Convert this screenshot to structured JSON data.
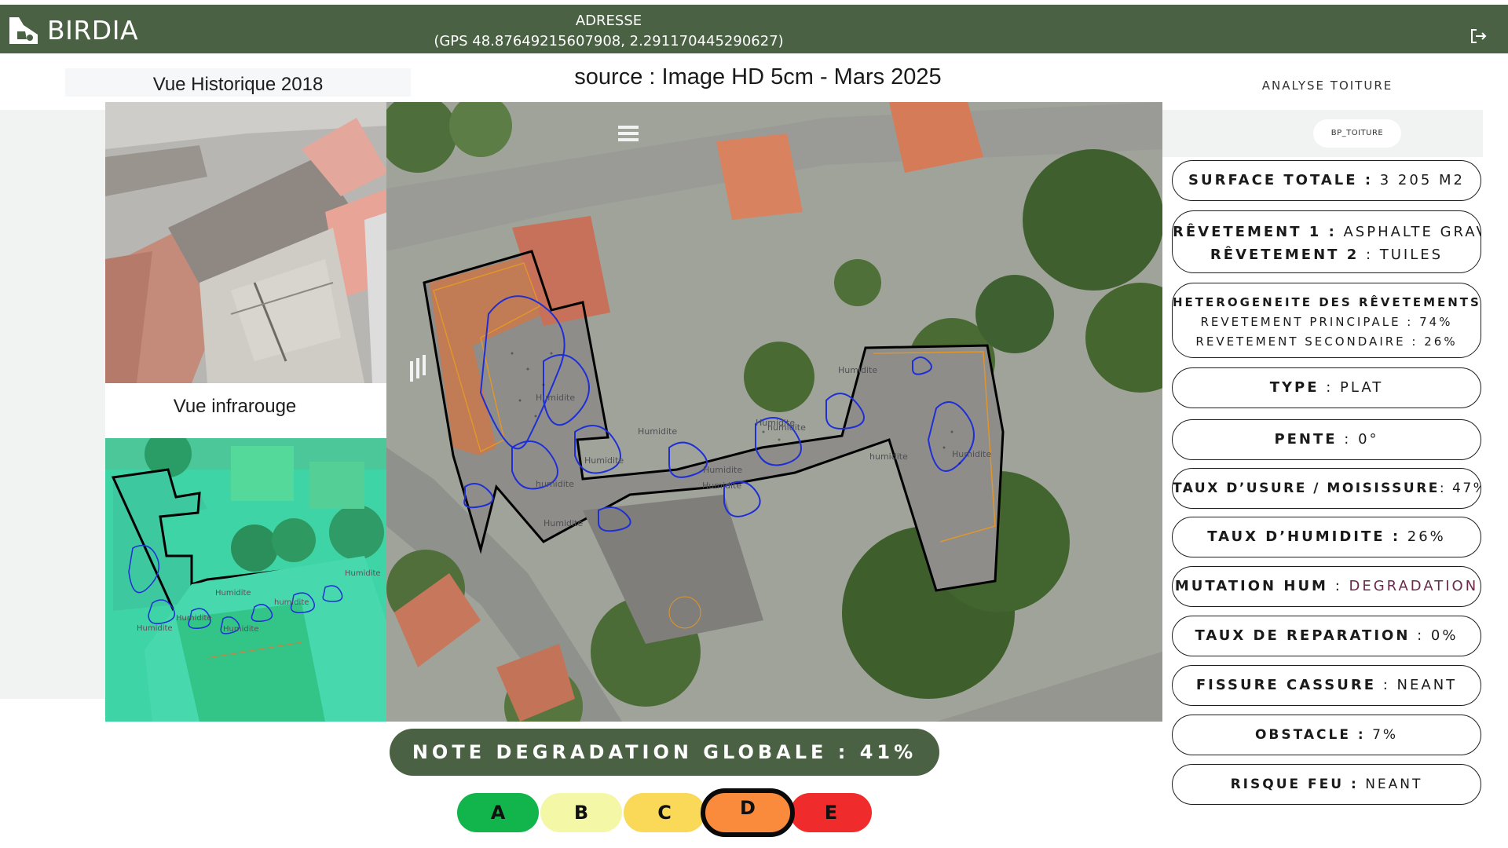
{
  "header": {
    "brand": "BIRDIA",
    "address_label": "ADRESSE",
    "address_value": "(GPS 48.87649215607908, 2.291170445290627)"
  },
  "left_panel": {
    "historic_title": "Vue Historique 2018",
    "infrared_title": "Vue infrarouge"
  },
  "main_view": {
    "source_title": "source : Image HD 5cm - Mars 2025",
    "map_annotations": [
      "Humidite",
      "humidite",
      "Humidite",
      "Humidite",
      "Humidite",
      "Humidite",
      "humidite",
      "Humidite",
      "humidite",
      "Humidite",
      "Humidite",
      "Humidite"
    ]
  },
  "infrared_annotations": [
    "Humidite",
    "humidite",
    "Humidite",
    "Humidite",
    "Humidite",
    "Humidite"
  ],
  "analysis": {
    "title": "ANALYSE TOITURE",
    "chip": "BP_TOITURE",
    "items": [
      {
        "key": "SURFACE TOTALE :",
        "value": " 3 205 M2"
      },
      {
        "key": "RÊVETEMENT 1 :",
        "value": " ASPHALTE GRAV",
        "key2": "RÊVETEMENT 2",
        "value2": " : TUILES"
      },
      {
        "key": "HETEROGENEITE DES RÊVETEMENTS :",
        "line2": "REVETEMENT PRINCIPALE : 74%",
        "line3": "REVETEMENT SECONDAIRE : 26%"
      },
      {
        "key": "TYPE",
        "value": " : PLAT"
      },
      {
        "key": "PENTE",
        "value": " : 0°"
      },
      {
        "key": "TAUX D’USURE / MOISISSURE",
        "value": ": 47%"
      },
      {
        "key": "TAUX D’HUMIDITE :",
        "value": " 26%"
      },
      {
        "key": "MUTATION HUM",
        "sep": " : ",
        "value": "DEGRADATION"
      },
      {
        "key": "TAUX DE REPARATION",
        "value": " : 0%"
      },
      {
        "key": "FISSURE CASSURE",
        "value": " : NEANT"
      },
      {
        "key": "OBSTACLE :",
        "value": " 7%"
      },
      {
        "key": "RISQUE FEU :",
        "value": " NEANT"
      }
    ]
  },
  "global_note": {
    "label": "NOTE DEGRADATION GLOBALE : 41%",
    "degradation_pct": 41
  },
  "grades": [
    {
      "letter": "A",
      "color": "#12b54b"
    },
    {
      "letter": "B",
      "color": "#f3f7a6"
    },
    {
      "letter": "C",
      "color": "#f9d957"
    },
    {
      "letter": "D",
      "color": "#fb8b3c",
      "selected": true
    },
    {
      "letter": "E",
      "color": "#ef2b2b"
    }
  ],
  "colors": {
    "brand_green": "#4a6144",
    "moisture_outline": "#1f2fd6",
    "roof_outline": "#000000",
    "texture_outline": "#e0962a"
  }
}
